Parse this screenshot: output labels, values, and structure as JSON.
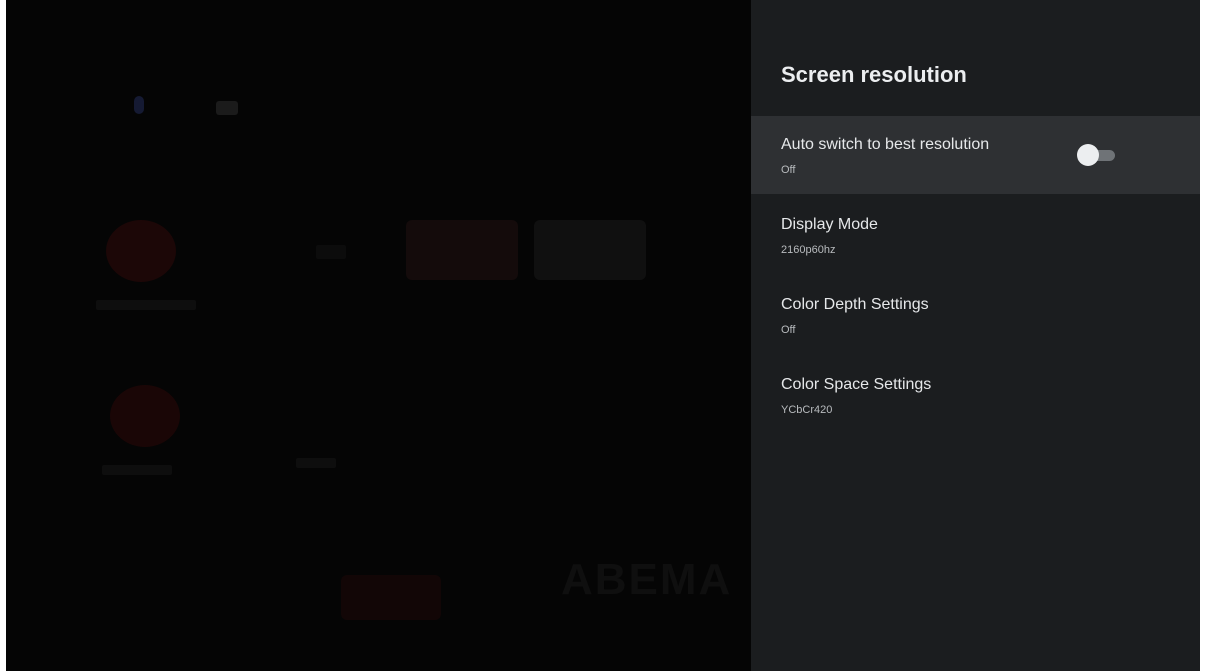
{
  "panel": {
    "title": "Screen resolution",
    "items": [
      {
        "label": "Auto switch to best resolution",
        "value": "Off",
        "toggle": "off",
        "focused": true
      },
      {
        "label": "Display Mode",
        "value": "2160p60hz"
      },
      {
        "label": "Color Depth Settings",
        "value": "Off"
      },
      {
        "label": "Color Space Settings",
        "value": "YCbCr420"
      }
    ]
  },
  "background": {
    "wordmark": "ABEMA"
  },
  "colors": {
    "panel_bg": "#1b1d1f",
    "focused_row": "#2e3033",
    "screen_bg": "#050505"
  }
}
